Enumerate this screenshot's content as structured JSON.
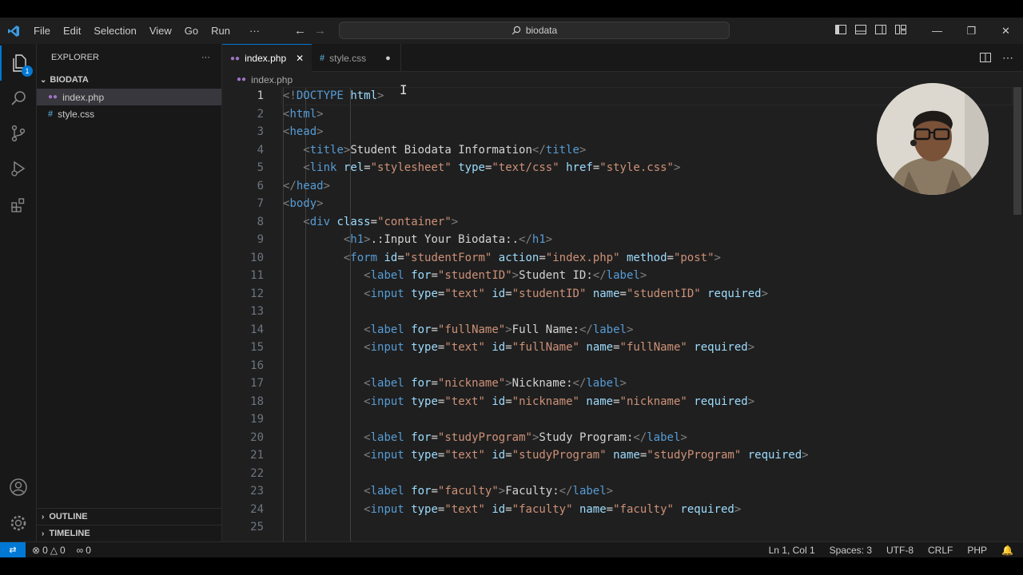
{
  "titlebar": {
    "menu": [
      "File",
      "Edit",
      "Selection",
      "View",
      "Go",
      "Run",
      "···"
    ],
    "search": "biodata"
  },
  "activitybar": {
    "explorer_badge": "1"
  },
  "sidebar": {
    "title": "EXPLORER",
    "more": "···",
    "folder": "BIODATA",
    "files": [
      "index.php",
      "style.css"
    ],
    "outline": "OUTLINE",
    "timeline": "TIMELINE"
  },
  "tabs": [
    {
      "label": "index.php",
      "icon": "php-file-icon",
      "state": "active"
    },
    {
      "label": "style.css",
      "icon": "css-file-icon",
      "state": "modified"
    }
  ],
  "breadcrumb": {
    "file": "index.php"
  },
  "editor": {
    "current_line": 1,
    "lines": [
      {
        "n": "1",
        "html": "<span class='t-punct'>&lt;!</span><span class='t-doc'>DOCTYPE</span> <span class='t-attr'>html</span><span class='t-punct'>&gt;</span>"
      },
      {
        "n": "2",
        "html": "<span class='t-punct'>&lt;</span><span class='t-tag'>html</span><span class='t-punct'>&gt;</span>"
      },
      {
        "n": "3",
        "html": "<span class='t-punct'>&lt;</span><span class='t-tag'>head</span><span class='t-punct'>&gt;</span>"
      },
      {
        "n": "4",
        "html": "   <span class='t-punct'>&lt;</span><span class='t-tag'>title</span><span class='t-punct'>&gt;</span><span class='t-text'>Student Biodata Information</span><span class='t-punct'>&lt;/</span><span class='t-tag'>title</span><span class='t-punct'>&gt;</span>"
      },
      {
        "n": "5",
        "html": "   <span class='t-punct'>&lt;</span><span class='t-tag'>link</span> <span class='t-attr'>rel</span><span class='t-text'>=</span><span class='t-str'>\"stylesheet\"</span> <span class='t-attr'>type</span><span class='t-text'>=</span><span class='t-str'>\"text/css\"</span> <span class='t-attr'>href</span><span class='t-text'>=</span><span class='t-str'>\"style.css\"</span><span class='t-punct'>&gt;</span>"
      },
      {
        "n": "6",
        "html": "<span class='t-punct'>&lt;/</span><span class='t-tag'>head</span><span class='t-punct'>&gt;</span>"
      },
      {
        "n": "7",
        "html": "<span class='t-punct'>&lt;</span><span class='t-tag'>body</span><span class='t-punct'>&gt;</span>"
      },
      {
        "n": "8",
        "html": "   <span class='t-punct'>&lt;</span><span class='t-tag'>div</span> <span class='t-attr'>class</span><span class='t-text'>=</span><span class='t-str'>\"container\"</span><span class='t-punct'>&gt;</span>"
      },
      {
        "n": "9",
        "html": "         <span class='t-punct'>&lt;</span><span class='t-tag'>h1</span><span class='t-punct'>&gt;</span><span class='t-text'>.:Input Your Biodata:.</span><span class='t-punct'>&lt;/</span><span class='t-tag'>h1</span><span class='t-punct'>&gt;</span>"
      },
      {
        "n": "10",
        "html": "         <span class='t-punct'>&lt;</span><span class='t-tag'>form</span> <span class='t-attr'>id</span><span class='t-text'>=</span><span class='t-str'>\"studentForm\"</span> <span class='t-attr'>action</span><span class='t-text'>=</span><span class='t-str'>\"index.php\"</span> <span class='t-attr'>method</span><span class='t-text'>=</span><span class='t-str'>\"post\"</span><span class='t-punct'>&gt;</span>"
      },
      {
        "n": "11",
        "html": "            <span class='t-punct'>&lt;</span><span class='t-tag'>label</span> <span class='t-attr'>for</span><span class='t-text'>=</span><span class='t-str'>\"studentID\"</span><span class='t-punct'>&gt;</span><span class='t-text'>Student ID:</span><span class='t-punct'>&lt;/</span><span class='t-tag'>label</span><span class='t-punct'>&gt;</span>"
      },
      {
        "n": "12",
        "html": "            <span class='t-punct'>&lt;</span><span class='t-tag'>input</span> <span class='t-attr'>type</span><span class='t-text'>=</span><span class='t-str'>\"text\"</span> <span class='t-attr'>id</span><span class='t-text'>=</span><span class='t-str'>\"studentID\"</span> <span class='t-attr'>name</span><span class='t-text'>=</span><span class='t-str'>\"studentID\"</span> <span class='t-attr'>required</span><span class='t-punct'>&gt;</span>"
      },
      {
        "n": "13",
        "html": ""
      },
      {
        "n": "14",
        "html": "            <span class='t-punct'>&lt;</span><span class='t-tag'>label</span> <span class='t-attr'>for</span><span class='t-text'>=</span><span class='t-str'>\"fullName\"</span><span class='t-punct'>&gt;</span><span class='t-text'>Full Name:</span><span class='t-punct'>&lt;/</span><span class='t-tag'>label</span><span class='t-punct'>&gt;</span>"
      },
      {
        "n": "15",
        "html": "            <span class='t-punct'>&lt;</span><span class='t-tag'>input</span> <span class='t-attr'>type</span><span class='t-text'>=</span><span class='t-str'>\"text\"</span> <span class='t-attr'>id</span><span class='t-text'>=</span><span class='t-str'>\"fullName\"</span> <span class='t-attr'>name</span><span class='t-text'>=</span><span class='t-str'>\"fullName\"</span> <span class='t-attr'>required</span><span class='t-punct'>&gt;</span>"
      },
      {
        "n": "16",
        "html": ""
      },
      {
        "n": "17",
        "html": "            <span class='t-punct'>&lt;</span><span class='t-tag'>label</span> <span class='t-attr'>for</span><span class='t-text'>=</span><span class='t-str'>\"nickname\"</span><span class='t-punct'>&gt;</span><span class='t-text'>Nickname:</span><span class='t-punct'>&lt;/</span><span class='t-tag'>label</span><span class='t-punct'>&gt;</span>"
      },
      {
        "n": "18",
        "html": "            <span class='t-punct'>&lt;</span><span class='t-tag'>input</span> <span class='t-attr'>type</span><span class='t-text'>=</span><span class='t-str'>\"text\"</span> <span class='t-attr'>id</span><span class='t-text'>=</span><span class='t-str'>\"nickname\"</span> <span class='t-attr'>name</span><span class='t-text'>=</span><span class='t-str'>\"nickname\"</span> <span class='t-attr'>required</span><span class='t-punct'>&gt;</span>"
      },
      {
        "n": "19",
        "html": ""
      },
      {
        "n": "20",
        "html": "            <span class='t-punct'>&lt;</span><span class='t-tag'>label</span> <span class='t-attr'>for</span><span class='t-text'>=</span><span class='t-str'>\"studyProgram\"</span><span class='t-punct'>&gt;</span><span class='t-text'>Study Program:</span><span class='t-punct'>&lt;/</span><span class='t-tag'>label</span><span class='t-punct'>&gt;</span>"
      },
      {
        "n": "21",
        "html": "            <span class='t-punct'>&lt;</span><span class='t-tag'>input</span> <span class='t-attr'>type</span><span class='t-text'>=</span><span class='t-str'>\"text\"</span> <span class='t-attr'>id</span><span class='t-text'>=</span><span class='t-str'>\"studyProgram\"</span> <span class='t-attr'>name</span><span class='t-text'>=</span><span class='t-str'>\"studyProgram\"</span> <span class='t-attr'>required</span><span class='t-punct'>&gt;</span>"
      },
      {
        "n": "22",
        "html": ""
      },
      {
        "n": "23",
        "html": "            <span class='t-punct'>&lt;</span><span class='t-tag'>label</span> <span class='t-attr'>for</span><span class='t-text'>=</span><span class='t-str'>\"faculty\"</span><span class='t-punct'>&gt;</span><span class='t-text'>Faculty:</span><span class='t-punct'>&lt;/</span><span class='t-tag'>label</span><span class='t-punct'>&gt;</span>"
      },
      {
        "n": "24",
        "html": "            <span class='t-punct'>&lt;</span><span class='t-tag'>input</span> <span class='t-attr'>type</span><span class='t-text'>=</span><span class='t-str'>\"text\"</span> <span class='t-attr'>id</span><span class='t-text'>=</span><span class='t-str'>\"faculty\"</span> <span class='t-attr'>name</span><span class='t-text'>=</span><span class='t-str'>\"faculty\"</span> <span class='t-attr'>required</span><span class='t-punct'>&gt;</span>"
      },
      {
        "n": "25",
        "html": ""
      }
    ]
  },
  "statusbar": {
    "errors": "0",
    "warnings": "0",
    "ports": "0",
    "position": "Ln 1, Col 1",
    "spaces": "Spaces: 3",
    "encoding": "UTF-8",
    "eol": "CRLF",
    "language": "PHP"
  },
  "colors": {
    "accent": "#0078d4",
    "editor_bg": "#1f1f1f",
    "sidebar_bg": "#181818"
  }
}
